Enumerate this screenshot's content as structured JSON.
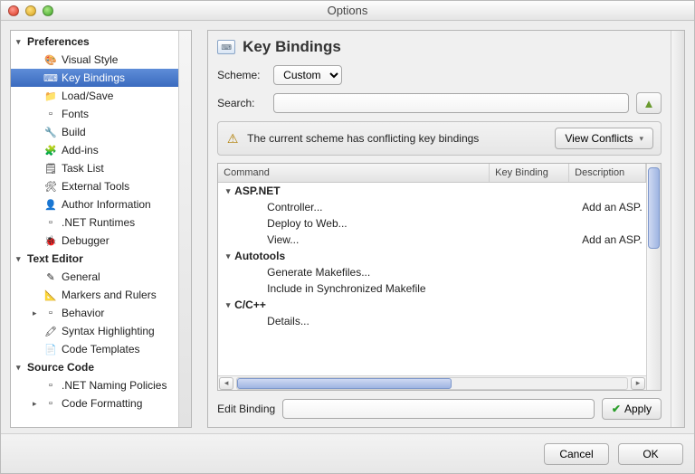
{
  "window": {
    "title": "Options"
  },
  "sidebar": {
    "groups": [
      {
        "label": "Preferences",
        "expanded": true,
        "items": [
          {
            "label": "Visual Style",
            "icon": "palette-icon"
          },
          {
            "label": "Key Bindings",
            "icon": "keyboard-icon",
            "selected": true
          },
          {
            "label": "Load/Save",
            "icon": "folder-icon"
          },
          {
            "label": "Fonts",
            "icon": "page-icon"
          },
          {
            "label": "Build",
            "icon": "blocks-icon"
          },
          {
            "label": "Add-ins",
            "icon": "puzzle-icon"
          },
          {
            "label": "Task List",
            "icon": "task-icon"
          },
          {
            "label": "External Tools",
            "icon": "tools-icon"
          },
          {
            "label": "Author Information",
            "icon": "user-icon"
          },
          {
            "label": ".NET Runtimes",
            "icon": "page-icon"
          },
          {
            "label": "Debugger",
            "icon": "bug-icon"
          }
        ]
      },
      {
        "label": "Text Editor",
        "expanded": true,
        "items": [
          {
            "label": "General",
            "icon": "edit-icon"
          },
          {
            "label": "Markers and Rulers",
            "icon": "ruler-icon"
          },
          {
            "label": "Behavior",
            "icon": "page-icon",
            "has_children": true
          },
          {
            "label": "Syntax Highlighting",
            "icon": "highlight-icon"
          },
          {
            "label": "Code Templates",
            "icon": "template-icon"
          }
        ]
      },
      {
        "label": "Source Code",
        "expanded": true,
        "items": [
          {
            "label": ".NET Naming Policies",
            "icon": "page-icon"
          },
          {
            "label": "Code Formatting",
            "icon": "page-icon",
            "has_children": true
          }
        ]
      }
    ]
  },
  "main": {
    "title": "Key Bindings",
    "scheme": {
      "label": "Scheme:",
      "value": "Custom"
    },
    "search": {
      "label": "Search:",
      "value": ""
    },
    "banner": {
      "text": "The current scheme has conflicting key bindings",
      "button_label": "View Conflicts"
    },
    "grid": {
      "columns": {
        "command": "Command",
        "key_binding": "Key Binding",
        "description": "Description"
      },
      "groups": [
        {
          "name": "ASP.NET",
          "rows": [
            {
              "command": "Controller...",
              "key_binding": "",
              "description": "Add an ASP.NET…"
            },
            {
              "command": "Deploy to Web...",
              "key_binding": "",
              "description": ""
            },
            {
              "command": "View...",
              "key_binding": "",
              "description": "Add an ASP.NET…"
            }
          ]
        },
        {
          "name": "Autotools",
          "rows": [
            {
              "command": "Generate Makefiles...",
              "key_binding": "",
              "description": ""
            },
            {
              "command": "Include in Synchronized Makefile",
              "key_binding": "",
              "description": ""
            }
          ]
        },
        {
          "name": "C/C++",
          "rows": [
            {
              "command": "Details...",
              "key_binding": "",
              "description": ""
            }
          ]
        }
      ]
    },
    "edit_binding": {
      "label": "Edit Binding",
      "value": "",
      "apply_label": "Apply"
    }
  },
  "footer": {
    "cancel": "Cancel",
    "ok": "OK"
  }
}
